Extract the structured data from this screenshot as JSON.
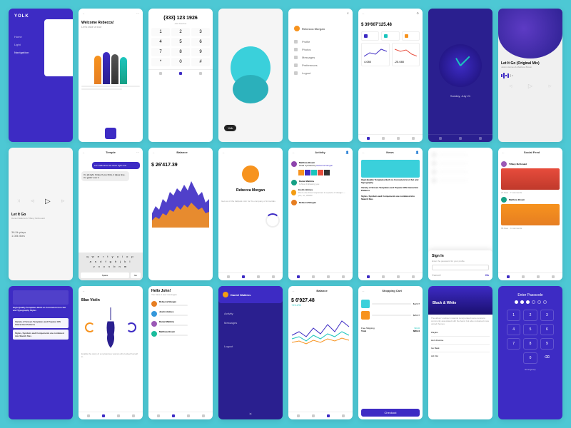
{
  "brand": "YOLK",
  "screens": {
    "s1": {
      "nav": [
        "Home",
        "Light",
        "Navigation"
      ]
    },
    "s2": {
      "greeting": "Welcome Rebecca!",
      "sub": "Let's take a tour"
    },
    "s3": {
      "phone": "(333) 123 1926",
      "hint": "Add Number",
      "keys": [
        "1",
        "2",
        "3",
        "4",
        "5",
        "6",
        "7",
        "8",
        "9",
        "*",
        "0",
        "#"
      ]
    },
    "s4": {
      "chip": "Yolk"
    },
    "s5": {
      "user": "Rebecca Morgan",
      "menu": [
        "Profile",
        "Photos",
        "Messages",
        "Preferences",
        "Logout"
      ]
    },
    "s6": {
      "title": "",
      "amount": "$ 39'607'125.48",
      "v1": "4.080",
      "v2": "-25.080"
    },
    "s7": {
      "date": "Sunday, July 21"
    },
    "s8": {
      "track": "Let It Go (Original Mix)",
      "artist": "Justin Holmes & Matthew Brown"
    },
    "s9": {
      "track": "Let It Go",
      "artist": "Daniel Watkins & Tiffany McDonald",
      "plays": "36.5k plays",
      "likes": "1.08k likes"
    },
    "s10": {
      "title": "Temple",
      "msg1": "Let's talk about an issue right now",
      "msg2": "I'm all right. Kinda. If you think, it takes time. I'm gettin' over it",
      "kb": "qwertyuiopasdfghjklzxcvbnm",
      "space": "Space",
      "go": "Go"
    },
    "s11": {
      "title": "Balance",
      "amount": "$ 26'417.39"
    },
    "s12": {
      "user": "Rebecca Morgan",
      "bio": "Get out of the ballpark. Aim for the company of immortals"
    },
    "s13": {
      "title": "Activity",
      "u1": "Matthew Brown",
      "a1": "Liked 3 photos by",
      "t1": "Rebecca Morgan",
      "u2": "Daniel Watkins",
      "a2": "Is Now Following you",
      "u3": "Justin Holmes",
      "a3": "There are three responses to a piece of design — yes, no, WOW!",
      "u4": "Rebecca Morgan"
    },
    "s14": {
      "title": "News",
      "h1": "High-Quality Templates Built on Consistent Icon Set and Typography",
      "h2": "Variety of Screen Templates and Popular iOS Interaction Patterns",
      "h3": "Styles, Symbols and Components are combined into Sketch files"
    },
    "s15": {
      "title": "Sign In",
      "hint": "Enter the password for your profile",
      "cancel": "Cancel",
      "ok": "Ok"
    },
    "s16": {
      "title": "Social Feed",
      "u1": "Tiffany McDonald",
      "m1": "27 likes · 7 comments",
      "u2": "Matthew Brown",
      "m2": "68 likes · 4 comments"
    },
    "s17": {
      "h1": "High-Quality Templates Built on Consistent Icon Set and Typography Styles",
      "h2": "Variety of Screen Templates and Popular iOS Interaction Patterns",
      "h3": "Styles, Symbols and Components are combined into Sketch files"
    },
    "s18": {
      "title": "Blue Violin",
      "cap": "Enable the story of a mysterious woman who locked herself in"
    },
    "s19": {
      "greet": "Hello John!",
      "sub": "You have 2 new messages",
      "u1": "Rebecca Morgan",
      "u2": "Justin Holmes",
      "u3": "Daniel Watkins",
      "u4": "Matthew Brown"
    },
    "s20": {
      "user": "Daniel Watkins",
      "menu": [
        "Activity",
        "Messages",
        "Logout"
      ]
    },
    "s21": {
      "title": "Balance",
      "amount": "$ 6'927.48",
      "delta": "+2.14%"
    },
    "s22": {
      "title": "Shopping Cart",
      "p1": "$12.97",
      "p2": "$25.97",
      "ship": "Free Shipping",
      "shipv": "$0.00",
      "tot": "Total",
      "totv": "$88.94",
      "btn": "Checkout"
    },
    "s23": {
      "title": "Black & White",
      "desc": "The album's subject material incorporated some tensions commonly associated with the band, but also contained more varied themes",
      "opt": [
        "Playlist",
        "Hot Universe",
        "Go Back",
        "Act Out"
      ]
    },
    "s24": {
      "title": "Enter Passcode",
      "keys": [
        "1",
        "2",
        "3",
        "4",
        "5",
        "6",
        "7",
        "8",
        "9",
        "",
        "0",
        ""
      ],
      "link": "Emergency"
    }
  },
  "colors": {
    "purple": "#3d2bc4",
    "orange": "#f7931e",
    "teal": "#1bc5bd",
    "cyan": "#3ad0db"
  }
}
